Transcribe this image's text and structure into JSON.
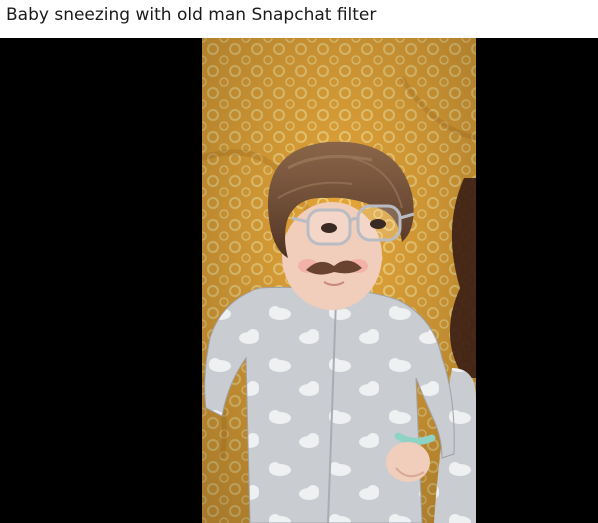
{
  "post": {
    "title": "Baby sneezing with old man Snapchat filter"
  },
  "media": {
    "type": "video-frame",
    "subject": "baby with wig, glasses and mustache filter lying on orange patterned blanket",
    "colors": {
      "letterbox": "#000000",
      "blanket": "#e8a83a",
      "pattern": "#f5d27a",
      "hair": "#6b4a34",
      "skin": "#f1cdbb",
      "onesie": "#c9ccd1",
      "clouds": "#eef0f2",
      "mustache": "#6a4330",
      "cuff": "#8fd3c4"
    }
  }
}
